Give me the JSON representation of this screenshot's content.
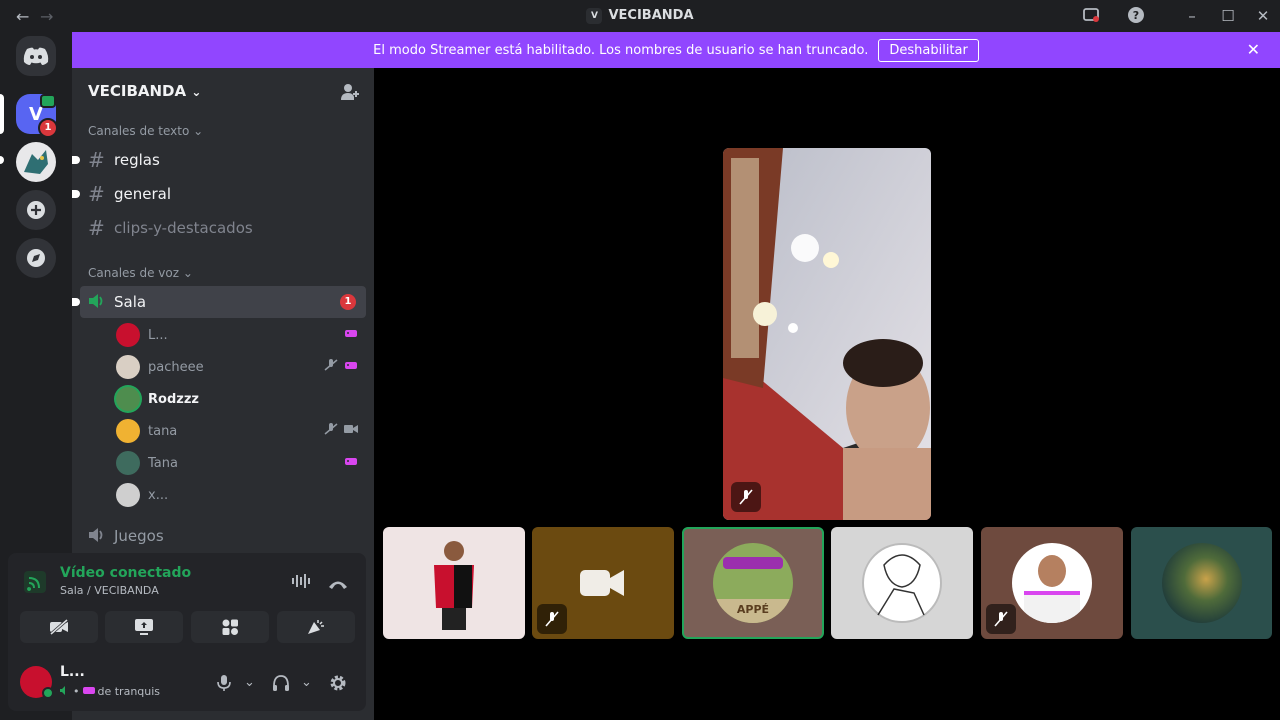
{
  "window": {
    "title": "VECIBANDA",
    "server_initial": "V"
  },
  "banner": {
    "message": "El modo Streamer está habilitado. Los nombres de usuario se han truncado.",
    "button_label": "Deshabilitar"
  },
  "rail": {
    "server_initial": "V",
    "mention_count": "1"
  },
  "sidebar": {
    "guild_name": "VECIBANDA",
    "text_category": "Canales de texto",
    "text_channels": [
      "reglas",
      "general",
      "clips-y-destacados"
    ],
    "voice_category": "Canales de voz",
    "voice_channels": [
      {
        "name": "Sala",
        "badge": "1"
      },
      {
        "name": "Juegos"
      }
    ],
    "voice_users": [
      {
        "name": "L...",
        "muted": false,
        "activity_icon": "game-icon",
        "color": "#c8102e"
      },
      {
        "name": "pacheee",
        "muted": true,
        "activity_icon": "game-icon",
        "color": "#d9cfc4"
      },
      {
        "name": "Rodzzz",
        "muted": false,
        "speaking": true,
        "color": "#4e8d4e"
      },
      {
        "name": "tana",
        "muted": true,
        "activity_icon": "video-icon",
        "color": "#f0b232"
      },
      {
        "name": "Tana",
        "muted": false,
        "activity_icon": "game-icon",
        "color": "#3e6b5e"
      },
      {
        "name": "x...",
        "muted": false,
        "color": "#cfcfcf"
      }
    ]
  },
  "voice_panel": {
    "status": "Vídeo conectado",
    "location": "Sala / VECIBANDA",
    "user_name": "L...",
    "user_status": "de tranquis"
  },
  "stage": {
    "tile_colors": [
      "#efe4e4",
      "#6b4a10",
      "#7a5f56",
      "#d6d6d6",
      "#6e4a3e",
      "#2b4f4c"
    ],
    "tile_label_3": "APPÉ"
  },
  "colors": {
    "accent": "#9146ff",
    "connected": "#23a55a",
    "danger": "#da373c"
  }
}
